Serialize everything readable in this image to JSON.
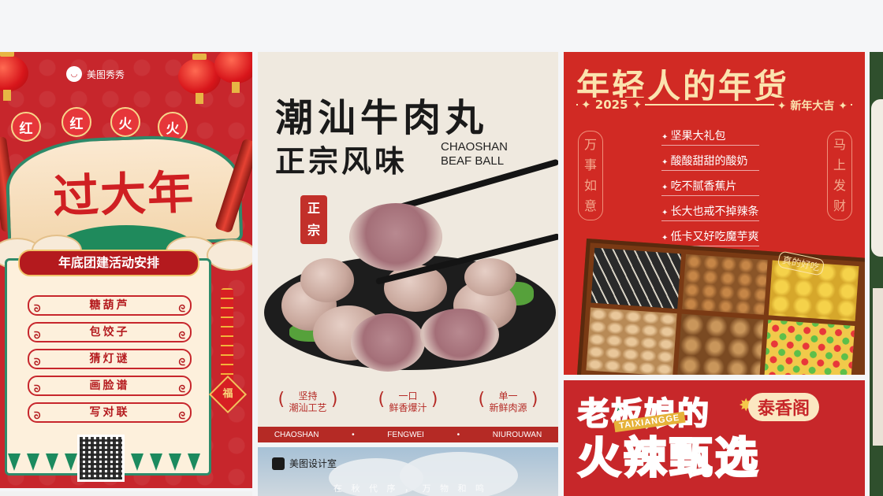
{
  "card_poster1": {
    "brand": "美图秀秀",
    "balls": [
      "红",
      "红",
      "火",
      "火"
    ],
    "headline": "过大年",
    "panel_title": "年底团建活动安排",
    "items": [
      "糖葫芦",
      "包饺子",
      "猜灯谜",
      "画脸谱",
      "写对联"
    ],
    "fu": "福"
  },
  "card_poster2": {
    "title_line1": "潮汕牛肉丸",
    "title_line2": "正宗风味",
    "english_line1": "CHAOSHAN",
    "english_line2": "BEAF BALL",
    "seal_top": "正",
    "seal_bottom": "宗",
    "tags": [
      {
        "l1": "坚持",
        "l2": "潮汕工艺"
      },
      {
        "l1": "一口",
        "l2": "鲜香爆汁"
      },
      {
        "l1": "单一",
        "l2": "新鲜肉源"
      }
    ],
    "strip": [
      "CHAOSHAN",
      "•",
      "FENGWEI",
      "•",
      "NIUROUWAN"
    ]
  },
  "card_poster3": {
    "brand": "美图设计室",
    "subtitle": "在 秋 代 序 ， 万 物 和 鸣"
  },
  "card_poster4": {
    "title": "年轻人的年货",
    "year": "✦ 2025 ✦",
    "new_year": "✦ 新年大吉 ✦",
    "left_vertical": [
      "万",
      "事",
      "如",
      "意"
    ],
    "right_vertical": [
      "马",
      "上",
      "发",
      "财"
    ],
    "list": [
      "坚果大礼包",
      "酸酸甜甜的酸奶",
      "吃不腻香蕉片",
      "长大也戒不掉辣条",
      "低卡又好吃魔芋爽"
    ],
    "note": "真的好吃"
  },
  "card_poster5": {
    "line1": "老板娘的",
    "line2": "火辣甄选",
    "shop": "泰香阁",
    "shop_en": "TAIXIANGGE"
  }
}
